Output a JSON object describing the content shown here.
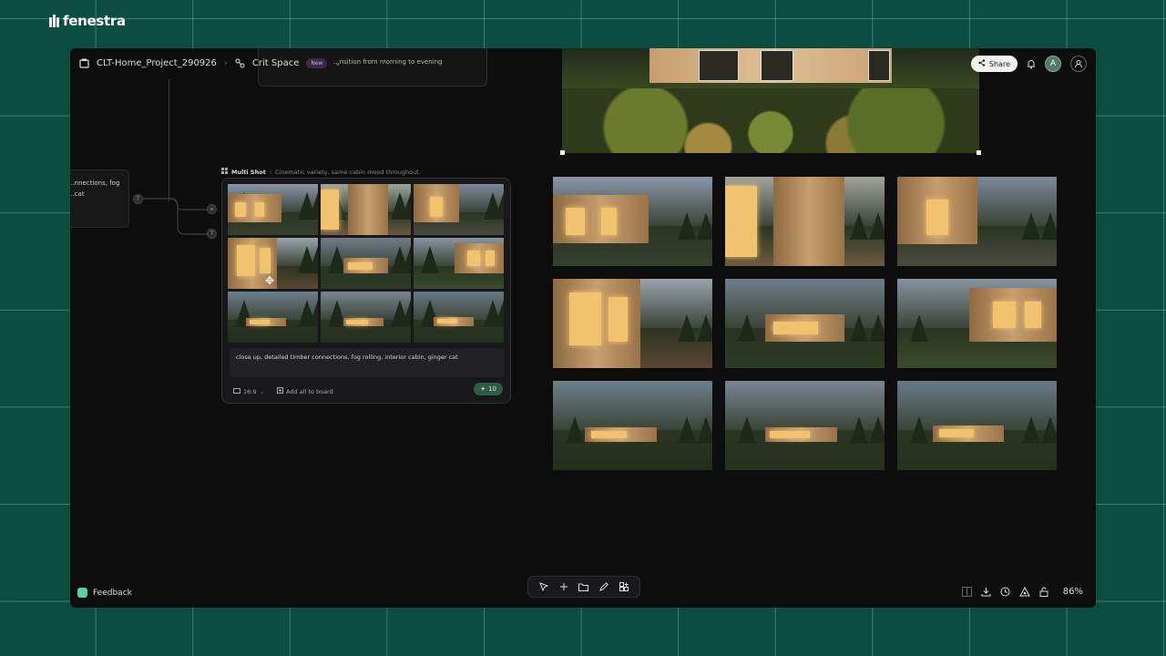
{
  "brand": {
    "name": "fenestra"
  },
  "header": {
    "project": "CLT-Home_Project_290926",
    "space": "Crit Space",
    "space_badge": "New",
    "share_label": "Share",
    "avatar_initial": "A"
  },
  "canvas": {
    "top_node_text": "...nsition from morning to evening",
    "left_node_lines": [
      "...nnections, fog",
      "...cat"
    ],
    "ports": [
      "T",
      "≡",
      "T"
    ]
  },
  "multishot": {
    "title": "Multi Shot",
    "subtitle": "Cinematic variety, same cabin mood throughout.",
    "prompt": "close up, detailed timber connections, fog rolling, interior cabin, ginger cat",
    "ratio": "16:9",
    "add_all": "Add all to board",
    "count": "10"
  },
  "footer": {
    "feedback": "Feedback",
    "zoom": "86%"
  },
  "icons": {
    "brand": "fenestra-logo-icon",
    "project": "project-icon",
    "space": "crit-space-icon",
    "bell": "bell-icon",
    "user": "user-icon",
    "select": "pointer-icon",
    "add": "plus-icon",
    "folder": "folder-icon",
    "pen": "pen-icon",
    "apps": "apps-icon",
    "panel": "panel-icon",
    "download": "download-icon",
    "history": "history-icon",
    "ai": "ai-icon",
    "lock": "lock-icon"
  },
  "colors": {
    "background": "#0b4d3f",
    "accent": "#2f5c44",
    "window_glow": "#f2c36e"
  }
}
